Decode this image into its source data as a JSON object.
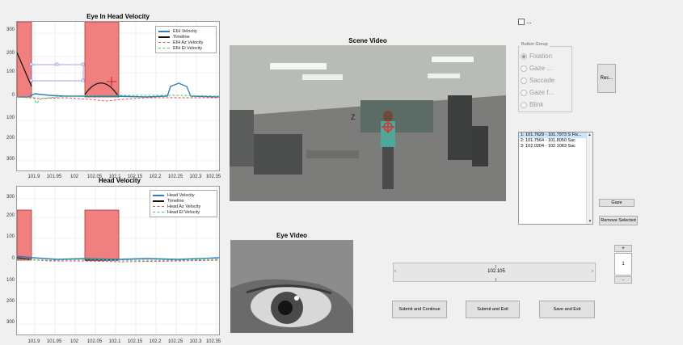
{
  "plots": {
    "eih": {
      "title": "Eye In Head Velocity",
      "yticks": [
        "300",
        "200",
        "100",
        "0",
        "100",
        "200",
        "300"
      ],
      "xticks": [
        "101.9",
        "101.95",
        "102",
        "102.05",
        "102.1",
        "102.15",
        "102.2",
        "102.25",
        "102.3",
        "102.35"
      ],
      "legend": [
        "EIH Velocity",
        "Timeline",
        "EIH Az Velocity",
        "EIH El Velocity"
      ]
    },
    "head": {
      "title": "Head Velocity",
      "yticks": [
        "300",
        "200",
        "100",
        "0",
        "100",
        "200",
        "300"
      ],
      "xticks": [
        "101.9",
        "101.95",
        "102",
        "102.05",
        "102.1",
        "102.15",
        "102.2",
        "102.25",
        "102.3",
        "102.35"
      ],
      "legend": [
        "Head Velocity",
        "Timeline",
        "Head Az Velocity",
        "Head El Velocity"
      ]
    },
    "colors": {
      "velocity": "#2e7fbf",
      "timeline": "#111111",
      "az": "#e0505a",
      "el": "#4fbf6a",
      "event_fill": "#f08080"
    }
  },
  "scene_video": {
    "title": "Scene Video",
    "overlay_letter": "Z"
  },
  "eye_video": {
    "title": "Eye Video"
  },
  "checkbox": {
    "label": "..."
  },
  "button_group": {
    "title": "Button Group",
    "options": [
      "Fixation",
      "Gaze ...",
      "Saccade",
      "Gaze f...",
      "Blink"
    ],
    "selected_index": 0
  },
  "rec_button": {
    "label": "Rec..."
  },
  "event_list": {
    "items": [
      "1: 101.7629 - 101.7973 S Fix...",
      "2: 101.7564 - 101.8050 Sac",
      "3: 102.0204 - 102.1063 Sac"
    ],
    "selected_index": 0
  },
  "buttons": {
    "gaze": "Gaze",
    "remove_selected": "Remove Selected",
    "submit_continue": "Submit and Continue",
    "submit_exit": "Submit and Exit",
    "save_exit": "Save and Exit"
  },
  "timeline_slider": {
    "value": "102.105"
  },
  "stepper": {
    "plus": "+",
    "value": "1",
    "minus": "-"
  }
}
